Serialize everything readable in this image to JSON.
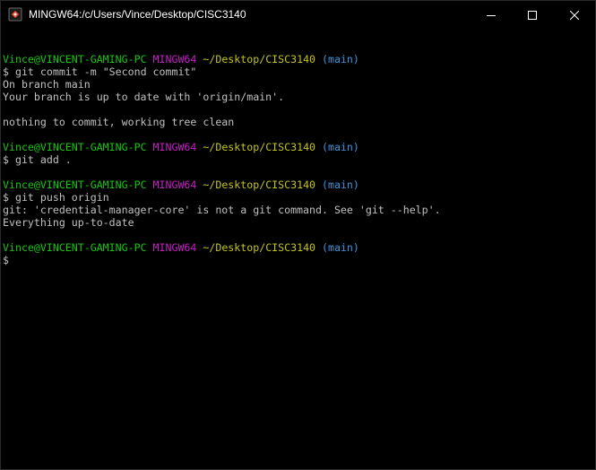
{
  "window": {
    "title": "MINGW64:/c/Users/Vince/Desktop/CISC3140",
    "minimize_label": "minimize",
    "maximize_label": "maximize",
    "close_label": "close",
    "app_icon": "git-bash-icon"
  },
  "colors": {
    "user": "#16c60c",
    "mingw": "#c71ec7",
    "path": "#c4c41c",
    "branch": "#3a96dd",
    "text": "#c0c0c0",
    "background": "#000000"
  },
  "prompt": {
    "user": "Vince@VINCENT-GAMING-PC",
    "env": "MINGW64",
    "path": "~/Desktop/CISC3140",
    "branch": "(main)",
    "symbol": "$"
  },
  "blocks": [
    {
      "command": "git commit -m \"Second commit\"",
      "output": [
        "On branch main",
        "Your branch is up to date with 'origin/main'.",
        "",
        "nothing to commit, working tree clean"
      ]
    },
    {
      "command": "git add .",
      "output": []
    },
    {
      "command": "git push origin",
      "output": [
        "git: 'credential-manager-core' is not a git command. See 'git --help'.",
        "Everything up-to-date"
      ]
    }
  ],
  "current_input": ""
}
